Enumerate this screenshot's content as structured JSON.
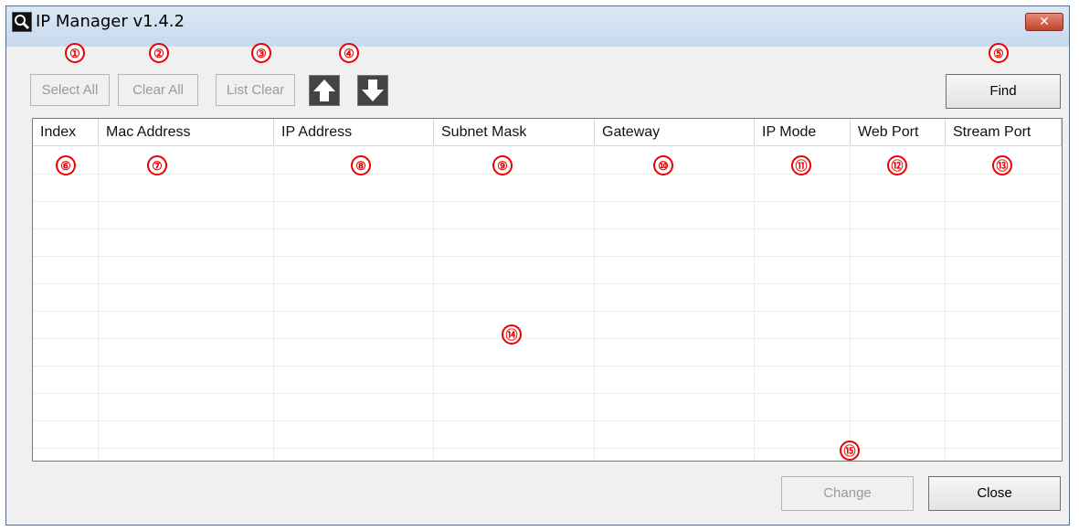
{
  "window": {
    "title": "IP Manager v1.4.2",
    "close_glyph": "✕"
  },
  "toolbar": {
    "select_all": "Select All",
    "clear_all": "Clear All",
    "list_clear": "List Clear",
    "find": "Find",
    "move_up_icon": "arrow-up-icon",
    "move_down_icon": "arrow-down-icon"
  },
  "table": {
    "columns": [
      "Index",
      "Mac Address",
      "IP Address",
      "Subnet Mask",
      "Gateway",
      "IP Mode",
      "Web Port",
      "Stream Port"
    ],
    "rows": []
  },
  "footer": {
    "change": "Change",
    "close": "Close"
  },
  "callouts": [
    "①",
    "②",
    "③",
    "④",
    "⑤",
    "⑥",
    "⑦",
    "⑧",
    "⑨",
    "⑩",
    "⑪",
    "⑫",
    "⑬",
    "⑭",
    "⑮"
  ],
  "colors": {
    "callout": "#e00000",
    "titlebar": "#c8d9ee",
    "close_button": "#c4412b"
  }
}
